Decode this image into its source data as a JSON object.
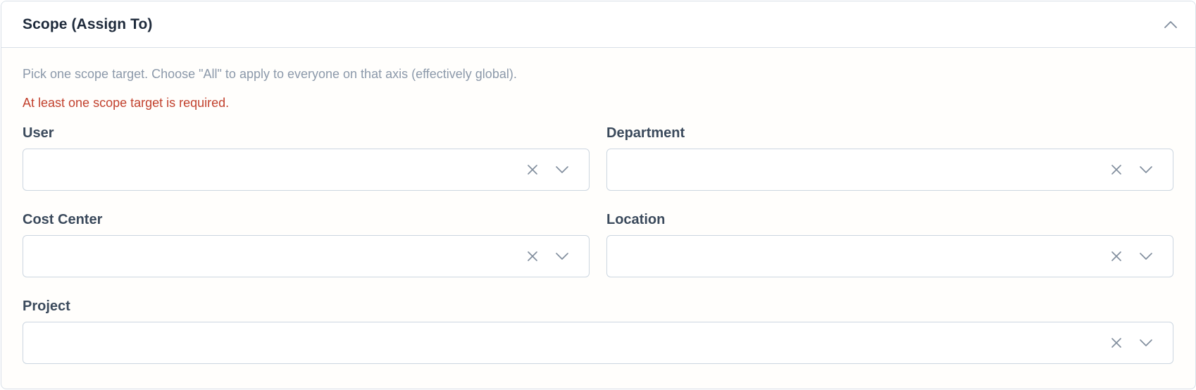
{
  "panel": {
    "title": "Scope (Assign To)",
    "collapse_icon": "chevron-up-icon"
  },
  "hint": "Pick one scope target. Choose \"All\" to apply to everyone on that axis (effectively global).",
  "error": "At least one scope target is required.",
  "fields": [
    {
      "label": "User",
      "value": ""
    },
    {
      "label": "Department",
      "value": ""
    },
    {
      "label": "Cost Center",
      "value": ""
    },
    {
      "label": "Location",
      "value": ""
    },
    {
      "label": "Project",
      "value": ""
    }
  ],
  "colors": {
    "title": "#1e2a3b",
    "hint": "#8c99aa",
    "error": "#c2412d",
    "label": "#3b4a5c",
    "border": "#ccd6e0",
    "icon": "#7f8c9c"
  }
}
